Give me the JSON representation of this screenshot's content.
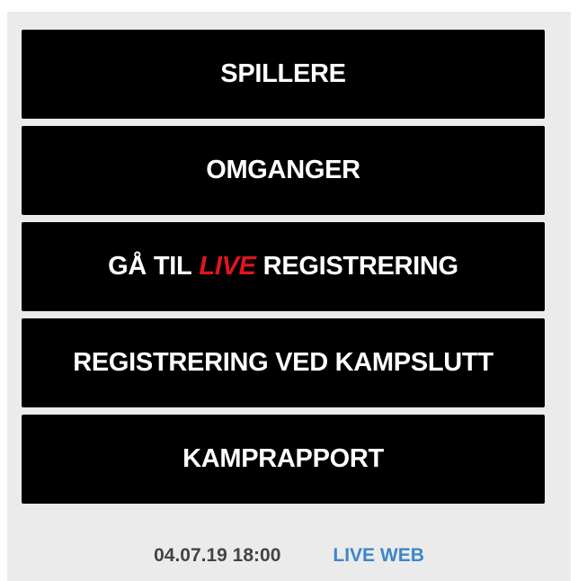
{
  "menu": {
    "players_label": "SPILLERE",
    "rounds_label": "OMGANGER",
    "live_registration": {
      "prefix": "GÅ TIL",
      "highlight": "LIVE",
      "suffix": "REGISTRERING"
    },
    "post_match_label": "REGISTRERING VED KAMPSLUTT",
    "match_report_label": "KAMPRAPPORT"
  },
  "footer": {
    "datetime": "04.07.19 18:00",
    "live_web_label": "LIVE WEB"
  },
  "colors": {
    "button_bg": "#000000",
    "button_text": "#ffffff",
    "live_highlight": "#e3141b",
    "link": "#3e86c6",
    "panel_bg": "#ebebeb"
  }
}
